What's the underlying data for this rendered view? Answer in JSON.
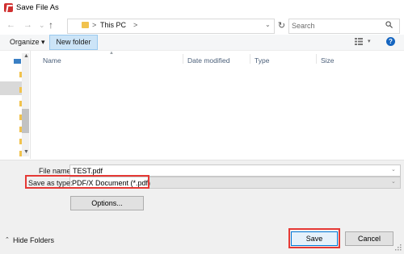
{
  "window": {
    "title": "Save File As"
  },
  "address": {
    "back_glyph": "←",
    "forward_glyph": "→",
    "recent_glyph": "⌄",
    "up_glyph": "↑",
    "sep1": ">",
    "current": "This PC",
    "sep2": ">",
    "dropdown_glyph": "⌄",
    "refresh_glyph": "↻"
  },
  "search": {
    "placeholder": "Search",
    "icon": "search-icon"
  },
  "toolbar": {
    "organize_label": "Organize ▾",
    "new_folder_label": "New folder",
    "view_dd_glyph": "▾",
    "help_label": "?"
  },
  "columns": [
    "Name",
    "Date modified",
    "Type",
    "Size"
  ],
  "nav": {
    "up_glyph": "▲",
    "down_glyph": "▼"
  },
  "form": {
    "file_name_label": "File name:",
    "file_name_value": "TEST.pdf",
    "save_type_label": "Save as type:",
    "save_type_value": "PDF/X Document (*.pdf)",
    "dropdown_glyph": "⌄",
    "options_label": "Options..."
  },
  "footer": {
    "hide_caret": "⌃",
    "hide_folders_label": "Hide Folders",
    "save_label": "Save",
    "cancel_label": "Cancel"
  },
  "colors": {
    "accent": "#0078d7",
    "highlight": "#e53935",
    "new_folder_bg": "#cce4f7",
    "folder": "#f1c24d"
  }
}
